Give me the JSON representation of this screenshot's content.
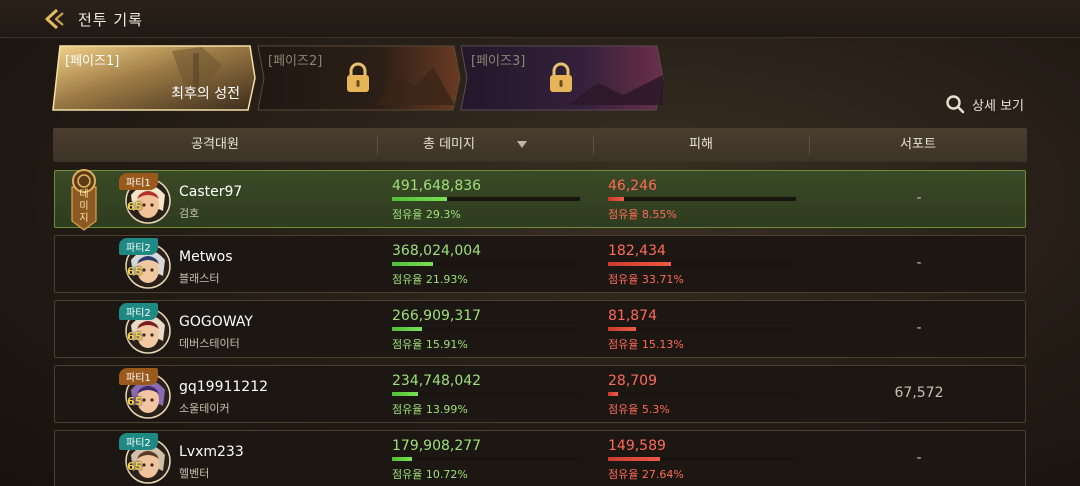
{
  "header": {
    "title": "전투 기록"
  },
  "tabs": [
    {
      "label": "[페이즈1]",
      "name": "최후의 성전",
      "locked": false
    },
    {
      "label": "[페이즈2]",
      "name": "",
      "locked": true
    },
    {
      "label": "[페이즈3]",
      "name": "",
      "locked": true
    }
  ],
  "detail_label": "상세 보기",
  "columns": {
    "attacker": "공격대원",
    "total_damage": "총 데미지",
    "damage_taken": "피해",
    "support": "서포트"
  },
  "medal_text": "데미지",
  "rows": [
    {
      "party": "파티1",
      "level": "65",
      "name": "Caster97",
      "class": "검호",
      "damage": "491,648,836",
      "damage_share": "점유율 29.3%",
      "damage_pct": 29.3,
      "taken": "46,246",
      "taken_share": "점유율 8.55%",
      "taken_pct": 8.55,
      "support": "-"
    },
    {
      "party": "파티2",
      "level": "65",
      "name": "Metwos",
      "class": "블래스터",
      "damage": "368,024,004",
      "damage_share": "점유율 21.93%",
      "damage_pct": 21.93,
      "taken": "182,434",
      "taken_share": "점유율 33.71%",
      "taken_pct": 33.71,
      "support": "-"
    },
    {
      "party": "파티2",
      "level": "65",
      "name": "GOGOWAY",
      "class": "데버스테이터",
      "damage": "266,909,317",
      "damage_share": "점유율 15.91%",
      "damage_pct": 15.91,
      "taken": "81,874",
      "taken_share": "점유율 15.13%",
      "taken_pct": 15.13,
      "support": "-"
    },
    {
      "party": "파티1",
      "level": "65",
      "name": "gq19911212",
      "class": "소울테이커",
      "damage": "234,748,042",
      "damage_share": "점유율 13.99%",
      "damage_pct": 13.99,
      "taken": "28,709",
      "taken_share": "점유율 5.3%",
      "taken_pct": 5.3,
      "support": "67,572"
    },
    {
      "party": "파티2",
      "level": "65",
      "name": "Lvxm233",
      "class": "헬벤터",
      "damage": "179,908,277",
      "damage_share": "점유율 10.72%",
      "damage_pct": 10.72,
      "taken": "149,589",
      "taken_share": "점유율 27.64%",
      "taken_pct": 27.64,
      "support": "-"
    }
  ],
  "colors": {
    "accent_gold": "#e7b964",
    "damage_green": "#9ee07a",
    "taken_red": "#ff6a5a",
    "party1": "#9a5a1b",
    "party2": "#1f8a83"
  }
}
